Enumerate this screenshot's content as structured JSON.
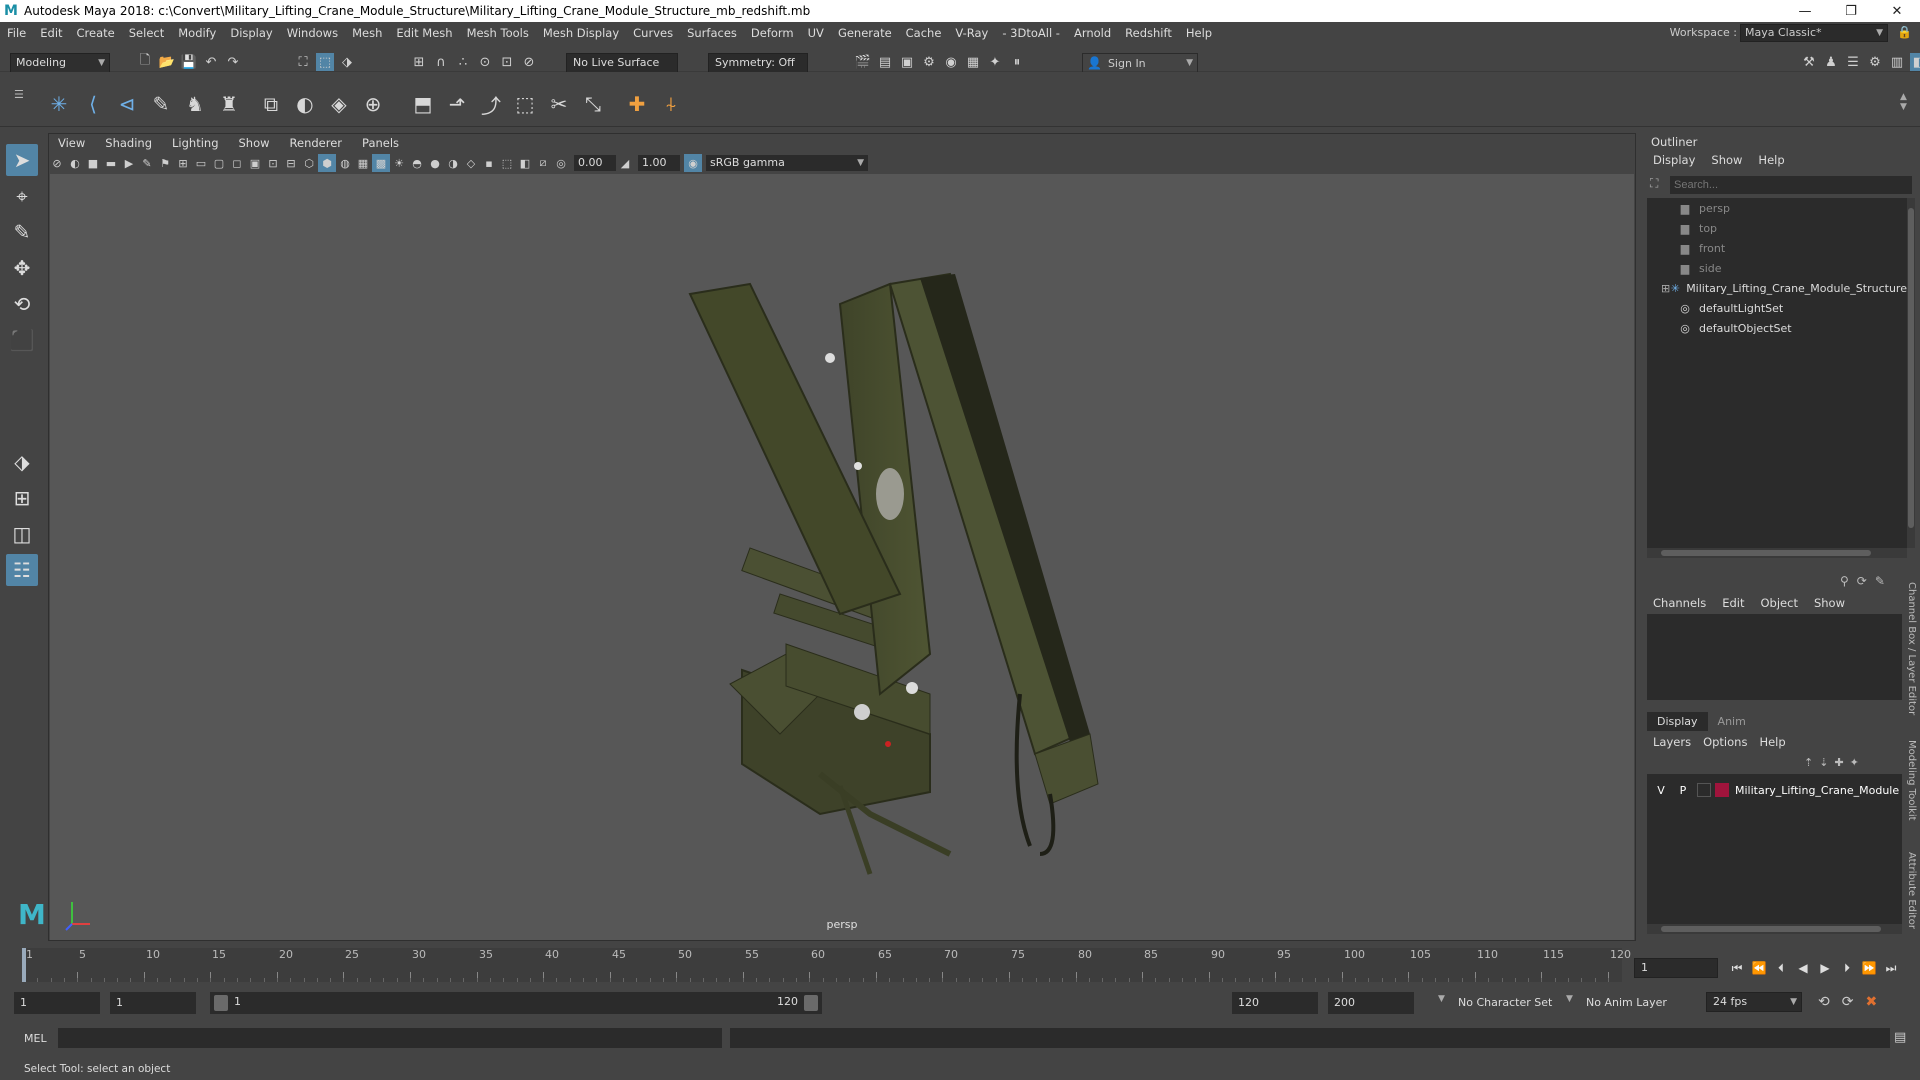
{
  "window": {
    "title": "Autodesk Maya 2018: c:\\Convert\\Military_Lifting_Crane_Module_Structure\\Military_Lifting_Crane_Module_Structure_mb_redshift.mb",
    "logo": "M"
  },
  "menubar": {
    "items": [
      "File",
      "Edit",
      "Create",
      "Select",
      "Modify",
      "Display",
      "Windows",
      "Mesh",
      "Edit Mesh",
      "Mesh Tools",
      "Mesh Display",
      "Curves",
      "Surfaces",
      "Deform",
      "UV",
      "Generate",
      "Cache",
      "V-Ray",
      "- 3DtoAll -",
      "Arnold",
      "Redshift",
      "Help"
    ],
    "workspace_label": "Workspace :",
    "workspace_value": "Maya Classic*"
  },
  "statusline": {
    "mode": "Modeling",
    "live_surface": "No Live Surface",
    "symmetry": "Symmetry: Off",
    "sign_in": "Sign In"
  },
  "viewport": {
    "menu": [
      "View",
      "Shading",
      "Lighting",
      "Show",
      "Renderer",
      "Panels"
    ],
    "exposure": "0.00",
    "gamma": "1.00",
    "color_space": "sRGB gamma",
    "camera_label": "persp"
  },
  "outliner": {
    "title": "Outliner",
    "menu": [
      "Display",
      "Show",
      "Help"
    ],
    "search_placeholder": "Search...",
    "items": [
      {
        "label": "persp",
        "icon": "camera-icon",
        "dim": true
      },
      {
        "label": "top",
        "icon": "camera-icon",
        "dim": true
      },
      {
        "label": "front",
        "icon": "camera-icon",
        "dim": true
      },
      {
        "label": "side",
        "icon": "camera-icon",
        "dim": true
      },
      {
        "label": "Military_Lifting_Crane_Module_Structure",
        "icon": "transform-icon",
        "dim": false
      },
      {
        "label": "defaultLightSet",
        "icon": "set-icon",
        "dim": false
      },
      {
        "label": "defaultObjectSet",
        "icon": "set-icon",
        "dim": false
      }
    ]
  },
  "channelbox": {
    "menu": [
      "Channels",
      "Edit",
      "Object",
      "Show"
    ],
    "layer_tabs": [
      "Display",
      "Anim"
    ],
    "layer_menu": [
      "Layers",
      "Options",
      "Help"
    ],
    "layer": {
      "v": "V",
      "p": "P",
      "name": "Military_Lifting_Crane_Module",
      "color": "#a0143c"
    }
  },
  "side_tabs": [
    "Channel Box / Layer Editor",
    "Modeling Toolkit",
    "Attribute Editor"
  ],
  "timeslider": {
    "ticks": [
      "1",
      "5",
      "10",
      "15",
      "20",
      "25",
      "30",
      "35",
      "40",
      "45",
      "50",
      "55",
      "60",
      "65",
      "70",
      "75",
      "80",
      "85",
      "90",
      "95",
      "100",
      "105",
      "110",
      "115",
      "120"
    ],
    "current_frame": "1"
  },
  "rangebar": {
    "start": "1",
    "anim_start": "1",
    "range_start": "1",
    "range_end": "120",
    "end": "120",
    "anim_end": "200",
    "character_set": "No Character Set",
    "anim_layer": "No Anim Layer",
    "fps": "24 fps"
  },
  "cmdline": {
    "label": "MEL"
  },
  "helpline": {
    "text": "Select Tool: select an object"
  }
}
